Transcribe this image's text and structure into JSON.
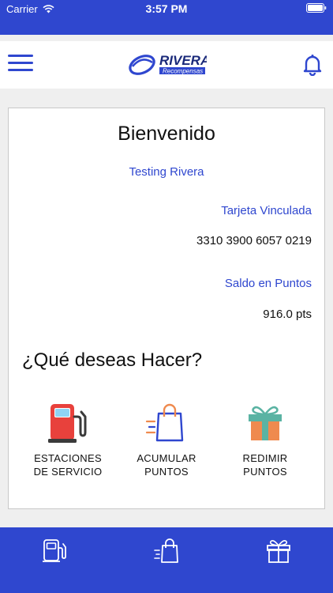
{
  "status": {
    "carrier": "Carrier",
    "time": "3:57 PM"
  },
  "header": {
    "logo_title": "RIVERA",
    "logo_subtitle": "Recompensas"
  },
  "card": {
    "welcome": "Bienvenido",
    "user_name": "Testing Rivera",
    "linked_card_label": "Tarjeta Vinculada",
    "linked_card_number": "3310 3900 6057 0219",
    "points_label": "Saldo en Puntos",
    "points_value": "916.0 pts",
    "question": "¿Qué deseas Hacer?"
  },
  "actions": [
    {
      "line1": "ESTACIONES",
      "line2": "DE SERVICIO",
      "icon": "fuel-pump-icon"
    },
    {
      "line1": "ACUMULAR",
      "line2": "PUNTOS",
      "icon": "shopping-bag-icon"
    },
    {
      "line1": "REDIMIR",
      "line2": "PUNTOS",
      "icon": "gift-icon"
    }
  ],
  "tabs": [
    {
      "icon": "fuel-pump-icon"
    },
    {
      "icon": "shopping-bag-icon"
    },
    {
      "icon": "gift-icon"
    }
  ],
  "colors": {
    "brand": "#2f47cf",
    "fuel_red": "#e8413c",
    "gift_orange": "#ef8a4e",
    "gift_green": "#5ab3a3"
  }
}
